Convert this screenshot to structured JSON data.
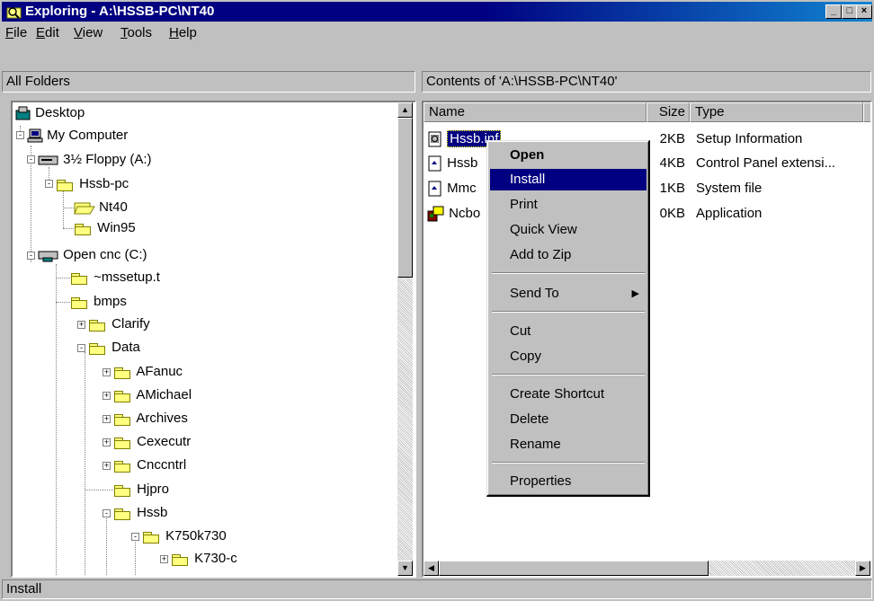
{
  "window": {
    "title": "Exploring - A:\\HSSB-PC\\NT40",
    "controls": {
      "minimize": "_",
      "maximize": "□",
      "close": "×"
    }
  },
  "menubar": {
    "items": [
      {
        "label": "File",
        "accel": "F"
      },
      {
        "label": "Edit",
        "accel": "E"
      },
      {
        "label": "View",
        "accel": "V"
      },
      {
        "label": "Tools",
        "accel": "T"
      },
      {
        "label": "Help",
        "accel": "H"
      }
    ]
  },
  "left_pane": {
    "header": "All Folders",
    "tree": [
      {
        "label": "Desktop",
        "icon": "desktop-icon"
      },
      {
        "label": "My Computer",
        "icon": "computer-icon",
        "expander": "-"
      },
      {
        "label": "3½ Floppy (A:)",
        "icon": "floppy-drive-icon",
        "expander": "-"
      },
      {
        "label": "Hssb-pc",
        "icon": "folder-icon",
        "expander": "-"
      },
      {
        "label": "Nt40",
        "icon": "open-folder-icon"
      },
      {
        "label": "Win95",
        "icon": "folder-icon"
      },
      {
        "label": "Open cnc (C:)",
        "icon": "network-drive-icon",
        "expander": "-"
      },
      {
        "label": "~mssetup.t",
        "icon": "folder-icon"
      },
      {
        "label": "bmps",
        "icon": "folder-icon"
      },
      {
        "label": "Clarify",
        "icon": "folder-icon",
        "expander": "+"
      },
      {
        "label": "Data",
        "icon": "folder-icon",
        "expander": "-"
      },
      {
        "label": "AFanuc",
        "icon": "folder-icon",
        "expander": "+"
      },
      {
        "label": "AMichael",
        "icon": "folder-icon",
        "expander": "+"
      },
      {
        "label": "Archives",
        "icon": "folder-icon",
        "expander": "+"
      },
      {
        "label": "Cexecutr",
        "icon": "folder-icon",
        "expander": "+"
      },
      {
        "label": "Cnccntrl",
        "icon": "folder-icon",
        "expander": "+"
      },
      {
        "label": "Hjpro",
        "icon": "folder-icon"
      },
      {
        "label": "Hssb",
        "icon": "folder-icon",
        "expander": "-"
      },
      {
        "label": "K750k730",
        "icon": "folder-icon",
        "expander": "-"
      },
      {
        "label": "K730-c",
        "icon": "folder-icon",
        "expander": "+"
      }
    ]
  },
  "right_pane": {
    "header": "Contents of 'A:\\HSSB-PC\\NT40'",
    "columns": [
      "Name",
      "Size",
      "Type",
      ""
    ],
    "files": [
      {
        "name": "Hssb.inf",
        "size": "2KB",
        "type": "Setup Information",
        "icon": "setup-info-icon",
        "selected": true
      },
      {
        "name": "Hssb",
        "size": "4KB",
        "type": "Control Panel extensi...",
        "icon": "system-file-icon"
      },
      {
        "name": "Mmc",
        "size": "1KB",
        "type": "System file",
        "icon": "system-file-icon"
      },
      {
        "name": "Ncbo",
        "size": "0KB",
        "type": "Application",
        "icon": "application-icon"
      }
    ]
  },
  "context_menu": {
    "items": [
      {
        "label": "Open",
        "bold": true
      },
      {
        "label": "Install",
        "selected": true
      },
      {
        "label": "Print"
      },
      {
        "label": "Quick View"
      },
      {
        "label": "Add to Zip"
      },
      {
        "label": "Send To",
        "submenu": true
      },
      {
        "label": "Cut"
      },
      {
        "label": "Copy"
      },
      {
        "label": "Create Shortcut"
      },
      {
        "label": "Delete"
      },
      {
        "label": "Rename"
      },
      {
        "label": "Properties"
      }
    ]
  },
  "statusbar": {
    "text": "Install"
  }
}
